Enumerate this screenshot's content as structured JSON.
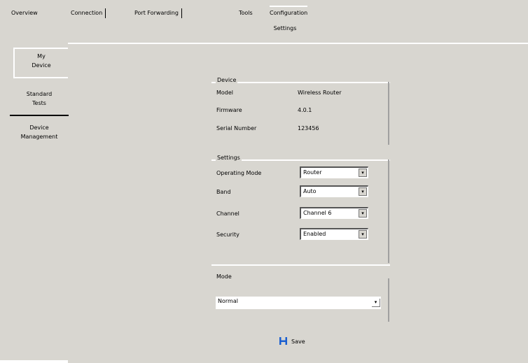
{
  "top_tabs": [
    {
      "label": "Overview"
    },
    {
      "label": "Connection"
    },
    {
      "label": "Port Forwarding"
    },
    {
      "label": "Tools"
    },
    {
      "label": "Configuration"
    }
  ],
  "sub_header": "Settings",
  "side_tabs": [
    {
      "line1": "My",
      "line2": "Device"
    },
    {
      "line1": "Standard",
      "line2": "Tests"
    },
    {
      "line1": "Device",
      "line2": "Management"
    }
  ],
  "device_group": {
    "title": "Device",
    "rows": [
      {
        "label": "Model",
        "value": "Wireless Router"
      },
      {
        "label": "Firmware",
        "value": "4.0.1"
      },
      {
        "label": "Serial Number",
        "value": "123456"
      }
    ]
  },
  "settings_group": {
    "title": "Settings",
    "rows": [
      {
        "label": "Operating Mode",
        "value": "Router"
      },
      {
        "label": "Band",
        "value": "Auto"
      },
      {
        "label": "Channel",
        "value": "Channel 6"
      },
      {
        "label": "Security",
        "value": "Enabled"
      }
    ]
  },
  "extra_group": {
    "title": "Mode",
    "select_value": "Normal"
  },
  "save": {
    "label": "Save",
    "icon": "save-icon",
    "icon_color": "#1a5fd0"
  },
  "colors": {
    "background": "#d8d6d0",
    "highlight": "#ffffff",
    "shadow": "#a0a0a0"
  }
}
